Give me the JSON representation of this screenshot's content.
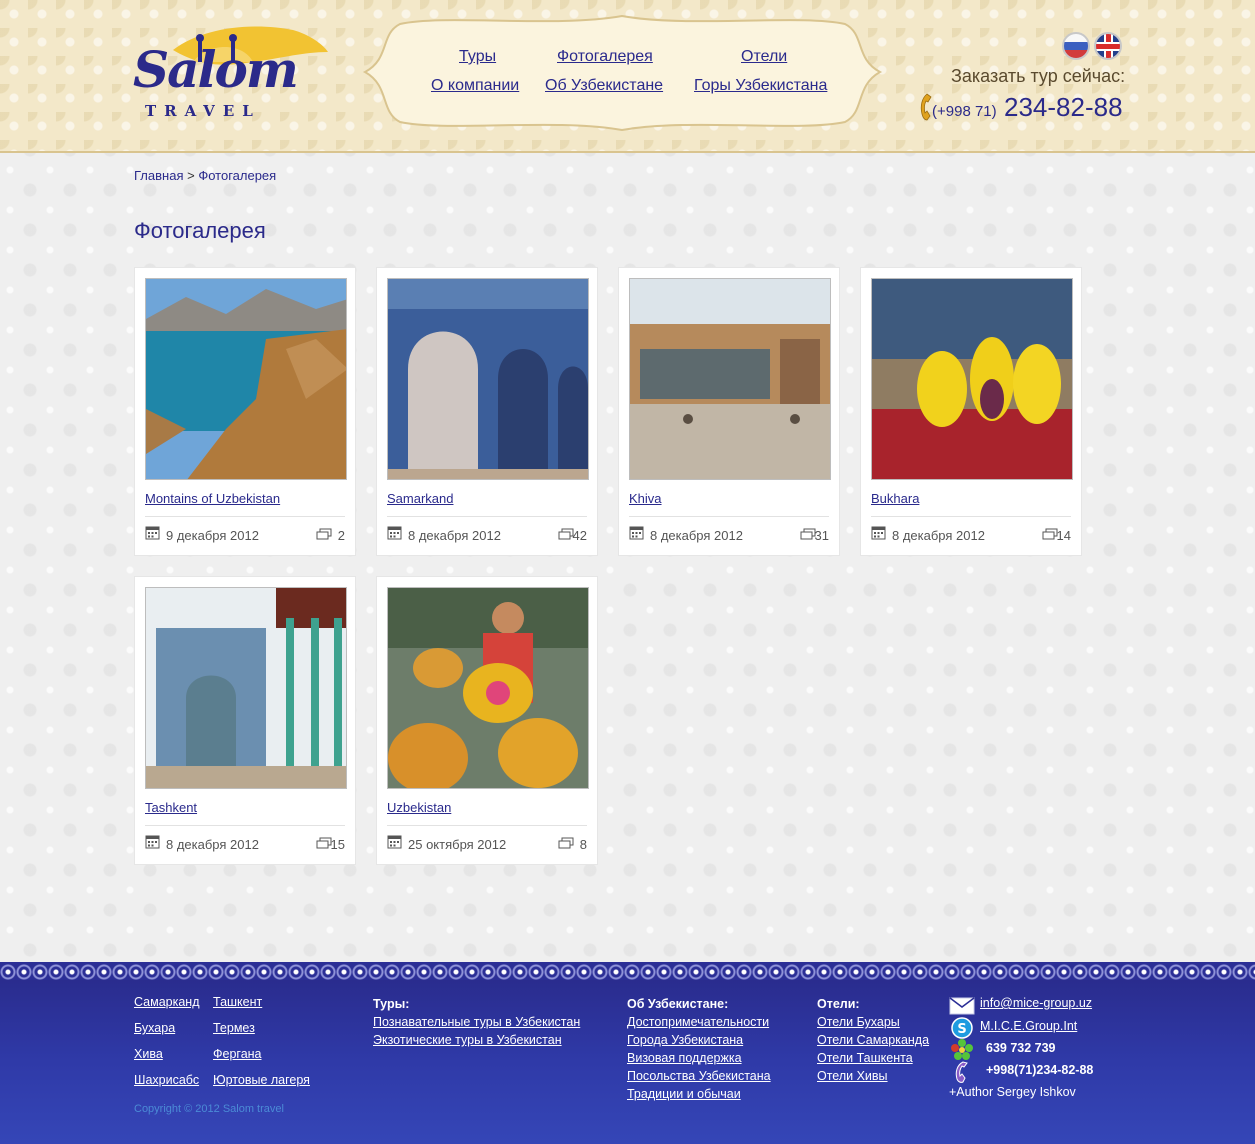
{
  "brand": {
    "name": "Salom",
    "sub": "TRAVEL"
  },
  "nav": {
    "row1": [
      "Туры",
      "Фотогалерея",
      "Отели"
    ],
    "row2": [
      "О компании",
      "Об Узбекистане",
      "Горы Узбекистана"
    ]
  },
  "header": {
    "order_label": "Заказать тур сейчас:",
    "phone_code": "(+998 71)",
    "phone_number": "234-82-88"
  },
  "breadcrumb": {
    "home": "Главная",
    "separator": ">",
    "current": "Фотогалерея"
  },
  "page": {
    "title": "Фотогалерея"
  },
  "albums": [
    {
      "title": "Montains of Uzbekistan",
      "date": "9 декабря 2012",
      "count": "2"
    },
    {
      "title": "Samarkand",
      "date": "8 декабря 2012",
      "count": "42"
    },
    {
      "title": "Khiva",
      "date": "8 декабря 2012",
      "count": "31"
    },
    {
      "title": "Bukhara",
      "date": "8 декабря 2012",
      "count": "14"
    },
    {
      "title": "Tashkent",
      "date": "8 декабря 2012",
      "count": "15"
    },
    {
      "title": "Uzbekistan",
      "date": "25 октября 2012",
      "count": "8"
    }
  ],
  "footer": {
    "cities": [
      "Самарканд",
      "Ташкент",
      "Бухара",
      "Термез",
      "Хива",
      "Фергана",
      "Шахрисабс",
      "Юртовые лагеря"
    ],
    "tours": {
      "heading": "Туры:",
      "items": [
        "Познавательные туры в Узбекистан",
        "Экзотические туры в Узбекистан"
      ]
    },
    "about": {
      "heading": "Об Узбекистане:",
      "items": [
        "Достопримечательности",
        "Города Узбекистана ",
        "Визовая поддержка",
        "Посольства Узбекистана",
        "Традиции и обычаи"
      ]
    },
    "hotels": {
      "heading": "Отели:",
      "items": [
        "Отели Бухары",
        "Отели Самарканда",
        "Отели Ташкента",
        "Отели Хивы"
      ]
    },
    "contacts": {
      "email": " info@mice-group.uz ",
      "skype": " M.I.C.E.Group.Int",
      "icq": "639 732 739",
      "phone": "+998(71)234-82-88",
      "author": "+Author Sergey Ishkov"
    },
    "copyright": "Copyright © 2012 Salom travel"
  },
  "colors": {
    "accent": "#2b2a8a",
    "header_bg": "#f3e8c9",
    "footer_bg": "#2f3aa8"
  }
}
